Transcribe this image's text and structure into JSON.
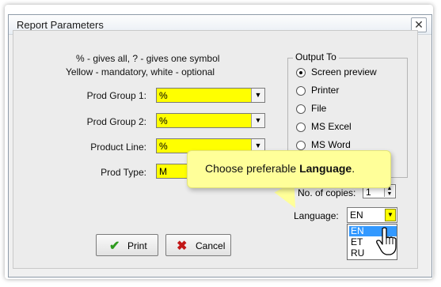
{
  "window": {
    "title": "Report Parameters",
    "close_glyph": "✕"
  },
  "hints": {
    "line1": "% - gives all, ? - gives one symbol",
    "line2": "Yellow - mandatory, white - optional"
  },
  "fields": [
    {
      "label": "Prod Group 1:",
      "value": "%"
    },
    {
      "label": "Prod Group 2:",
      "value": "%"
    },
    {
      "label": "Product Line:",
      "value": "%"
    },
    {
      "label": "Prod Type:",
      "value": "M"
    }
  ],
  "output": {
    "title": "Output To",
    "options": [
      "Screen preview",
      "Printer",
      "File",
      "MS Excel",
      "MS Word"
    ],
    "selected": "Screen preview"
  },
  "copies": {
    "label": "No. of copies:",
    "value": "1"
  },
  "language": {
    "label": "Language:",
    "value": "EN",
    "options": [
      "EN",
      "ET",
      "RU"
    ],
    "highlighted": "EN"
  },
  "buttons": {
    "print": "Print",
    "cancel": "Cancel"
  },
  "callout": {
    "text_prefix": "Choose preferable ",
    "text_bold": "Language",
    "text_suffix": "."
  },
  "colors": {
    "mandatory": "#ffff00",
    "callout": "#ffff99",
    "selection": "#3399ff"
  },
  "icons": {
    "print": "checkmark-icon",
    "cancel": "x-icon",
    "cursor": "hand-cursor-icon"
  }
}
